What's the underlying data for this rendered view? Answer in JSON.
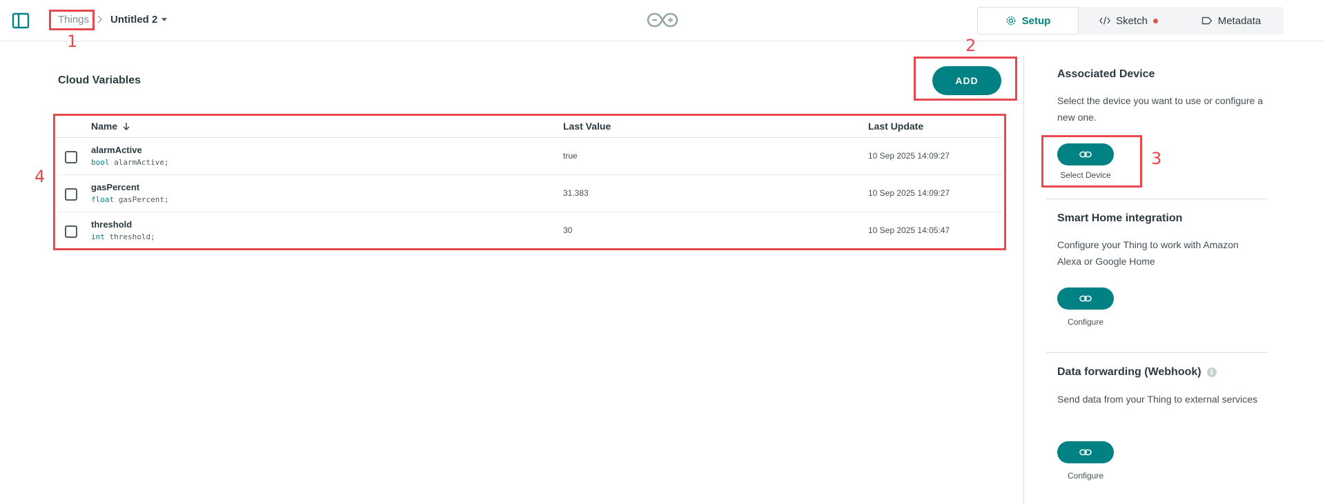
{
  "header": {
    "breadcrumb_root": "Things",
    "thing_title": "Untitled 2",
    "tabs": [
      {
        "label": "Setup",
        "active": true
      },
      {
        "label": "Sketch",
        "active": false,
        "unsaved_dot": true
      },
      {
        "label": "Metadata",
        "active": false
      }
    ]
  },
  "main": {
    "title": "Cloud Variables",
    "add_label": "ADD",
    "columns": [
      "Name",
      "Last Value",
      "Last Update"
    ],
    "rows": [
      {
        "name": "alarmActive",
        "type": "bool",
        "decl": "alarmActive;",
        "value": "true",
        "updated": "10 Sep 2025 14:09:27"
      },
      {
        "name": "gasPercent",
        "type": "float",
        "decl": "gasPercent;",
        "value": "31.383",
        "updated": "10 Sep 2025 14:09:27"
      },
      {
        "name": "threshold",
        "type": "int",
        "decl": "threshold;",
        "value": "30",
        "updated": "10 Sep 2025 14:05:47"
      }
    ]
  },
  "panel": {
    "device": {
      "title": "Associated Device",
      "text": "Select the device you want to use or configure a new one.",
      "button_label": "Select Device"
    },
    "smart_home": {
      "title": "Smart Home integration",
      "text": "Configure your Thing to work with Amazon Alexa or Google Home",
      "button_label": "Configure"
    },
    "webhook": {
      "title": "Data forwarding (Webhook)",
      "text": "Send data from your Thing to external services",
      "button_label": "Configure"
    }
  },
  "annotations": [
    "1",
    "2",
    "3",
    "4"
  ],
  "colors": {
    "accent": "#008184",
    "annotation": "#e8474c",
    "unsaved_dot": "#da5b4a"
  }
}
